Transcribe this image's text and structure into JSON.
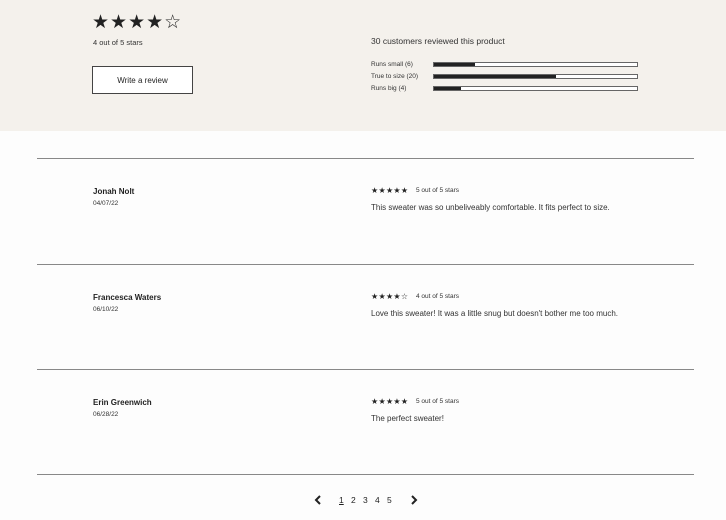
{
  "summary": {
    "stars": "★★★★☆",
    "average_text": "4 out of 5 stars",
    "write_review_label": "Write a review",
    "count_text": "30 customers reviewed this product",
    "fit": [
      {
        "label": "Runs small (6)",
        "fraction": 0.2
      },
      {
        "label": "True to size (20)",
        "fraction": 0.6
      },
      {
        "label": "Runs big (4)",
        "fraction": 0.133
      }
    ]
  },
  "reviews": [
    {
      "name": "Jonah Nolt",
      "date": "04/07/22",
      "stars": "★★★★★",
      "rating_text": "5 out of 5 stars",
      "body": "This sweater was so unbeliveably comfortable. It fits perfect to size."
    },
    {
      "name": "Francesca Waters",
      "date": "06/10/22",
      "stars": "★★★★☆",
      "rating_text": "4 out of 5 stars",
      "body": "Love this sweater! It was a little snug but doesn't bother me too much."
    },
    {
      "name": "Erin Greenwich",
      "date": "06/28/22",
      "stars": "★★★★★",
      "rating_text": "5 out of 5 stars",
      "body": "The perfect sweater!"
    }
  ],
  "pagination": {
    "pages": [
      "1",
      "2",
      "3",
      "4",
      "5"
    ],
    "current": "1"
  }
}
